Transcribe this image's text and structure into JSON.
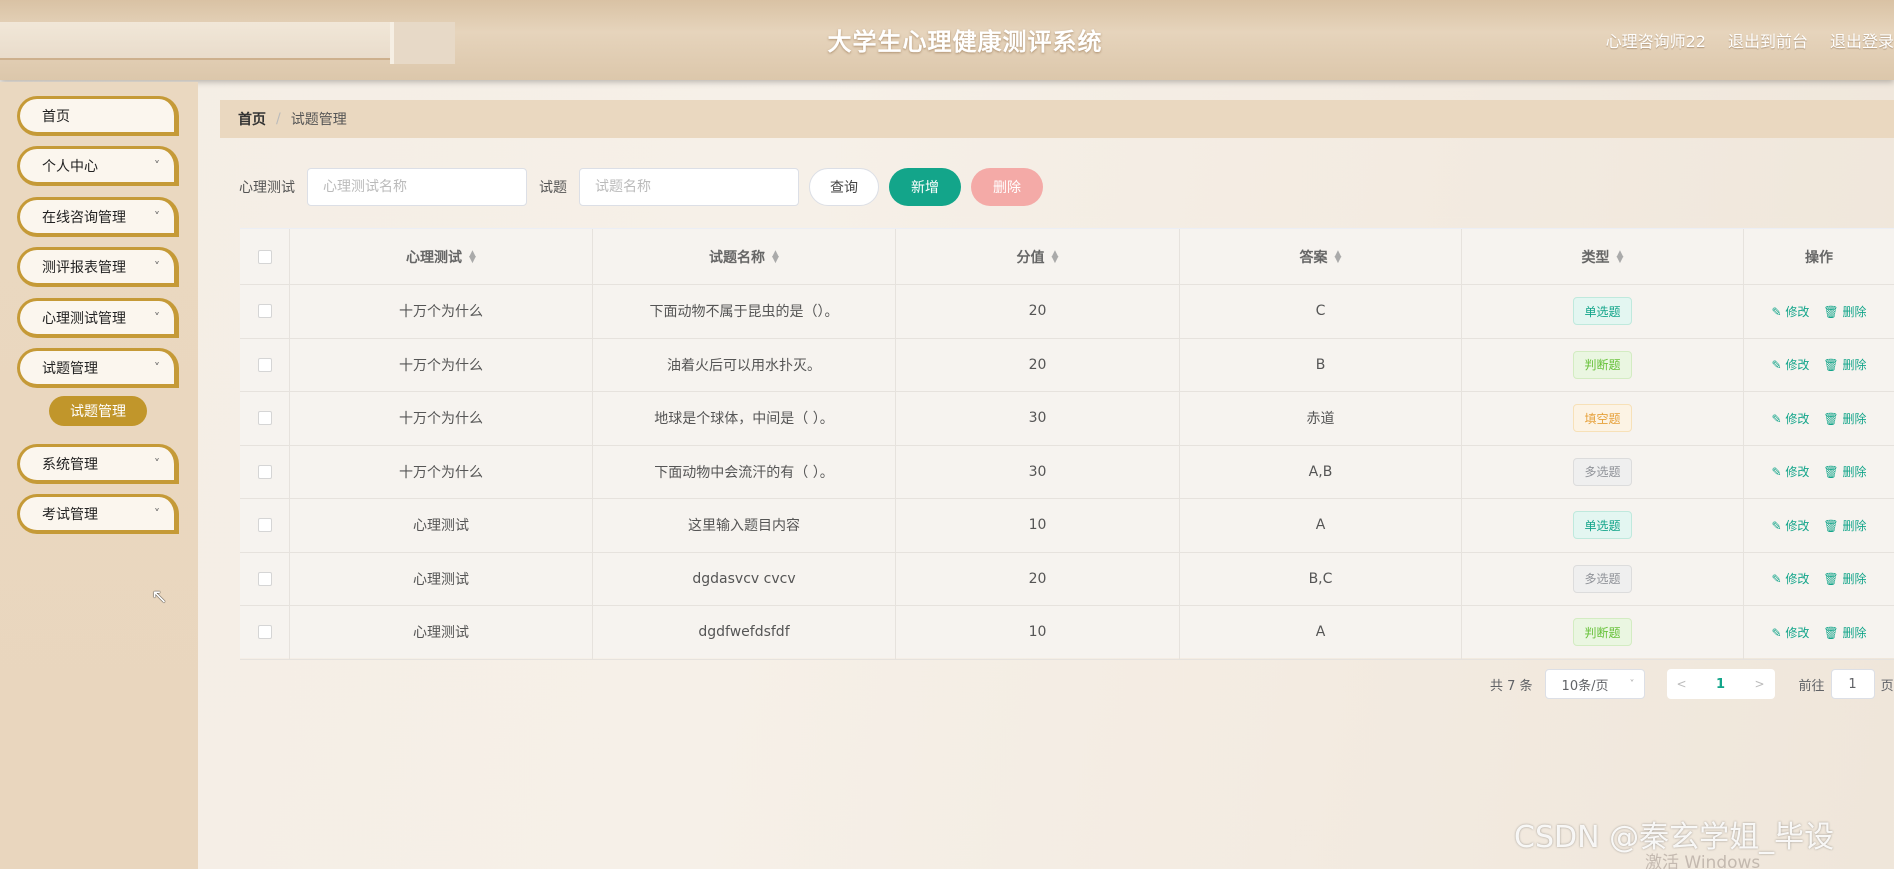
{
  "header": {
    "title": "大学生心理健康测评系统",
    "user": "心理咨询师22",
    "to_front": "退出到前台",
    "logout": "退出登录"
  },
  "sidebar": {
    "items": [
      {
        "label": "首页"
      },
      {
        "label": "个人中心"
      },
      {
        "label": "在线咨询管理"
      },
      {
        "label": "测评报表管理"
      },
      {
        "label": "心理测试管理"
      },
      {
        "label": "试题管理"
      },
      {
        "label": "系统管理"
      },
      {
        "label": "考试管理"
      }
    ],
    "sub_item": "试题管理",
    "chevron": "˅"
  },
  "breadcrumb": {
    "home": "首页",
    "separator": "/",
    "current": "试题管理"
  },
  "search": {
    "label1": "心理测试",
    "placeholder1": "心理测试名称",
    "label2": "试题",
    "placeholder2": "试题名称",
    "query": "查询",
    "add": "新增",
    "delete": "删除"
  },
  "table": {
    "columns": [
      "心理测试",
      "试题名称",
      "分值",
      "答案",
      "类型",
      "操作"
    ],
    "rows": [
      {
        "test": "十万个为什么",
        "name": "下面动物不属于昆虫的是（）。",
        "score": "20",
        "answer": "C",
        "type": "单选题",
        "type_kind": "single"
      },
      {
        "test": "十万个为什么",
        "name": "油着火后可以用水扑灭。",
        "score": "20",
        "answer": "B",
        "type": "判断题",
        "type_kind": "judge"
      },
      {
        "test": "十万个为什么",
        "name": "地球是个球体，中间是（ ）。",
        "score": "30",
        "answer": "赤道",
        "type": "填空题",
        "type_kind": "fill"
      },
      {
        "test": "十万个为什么",
        "name": "下面动物中会流汗的有（ ）。",
        "score": "30",
        "answer": "A,B",
        "type": "多选题",
        "type_kind": "multi"
      },
      {
        "test": "心理测试",
        "name": "这里输入题目内容",
        "score": "10",
        "answer": "A",
        "type": "单选题",
        "type_kind": "single"
      },
      {
        "test": "心理测试",
        "name": "dgdasvcv cvcv",
        "score": "20",
        "answer": "B,C",
        "type": "多选题",
        "type_kind": "multi"
      },
      {
        "test": "心理测试",
        "name": "dgdfwefdsfdf",
        "score": "10",
        "answer": "A",
        "type": "判断题",
        "type_kind": "judge"
      }
    ],
    "edit_label": "✎ 修改",
    "delete_label": "🗑 删除",
    "tag_colors": {
      "single": {
        "bg": "#e3f6f1",
        "border": "#bfe9dd",
        "color": "#13a58a"
      },
      "judge": {
        "bg": "#eaf6e1",
        "border": "#d3ecc2",
        "color": "#67c23a"
      },
      "fill": {
        "bg": "#fcf3e4",
        "border": "#f7e1b8",
        "color": "#e6a23c"
      },
      "multi": {
        "bg": "#efefef",
        "border": "#dcdcdc",
        "color": "#909399"
      }
    }
  },
  "pagination": {
    "total": "共 7 条",
    "page_size": "10条/页",
    "current_page": "1",
    "goto_prefix": "前往",
    "goto_value": "1",
    "goto_suffix": "页"
  },
  "watermark": {
    "text": "CSDN @秦玄学姐_毕设",
    "activate": "激活 Windows"
  }
}
